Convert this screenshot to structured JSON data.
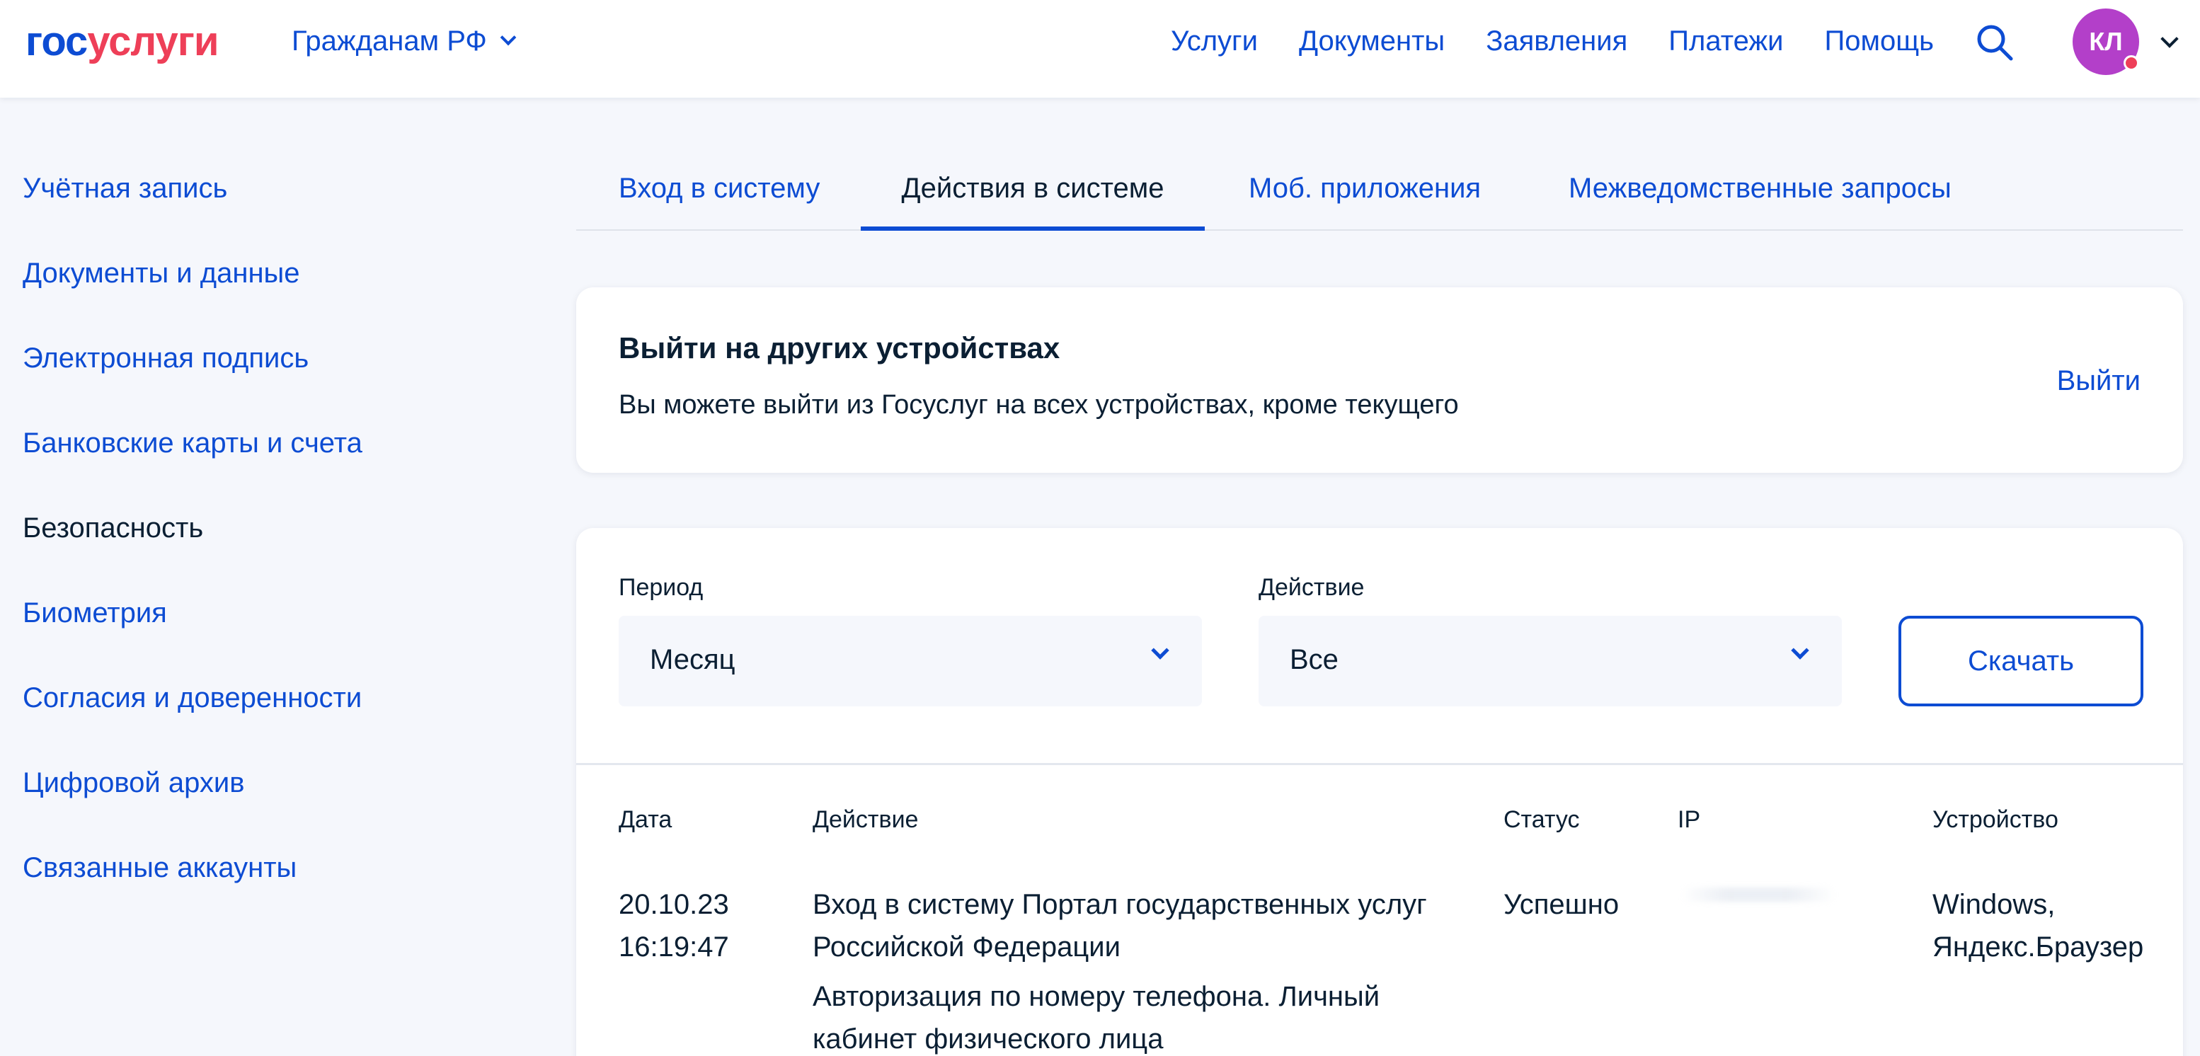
{
  "header": {
    "logo": {
      "part1": "гос",
      "part2": "услуги"
    },
    "audience": "Гражданам РФ",
    "nav": [
      "Услуги",
      "Документы",
      "Заявления",
      "Платежи",
      "Помощь"
    ],
    "avatar_initials": "КЛ",
    "colors": {
      "brand_blue": "#0d4cd3",
      "brand_red": "#ee3f58",
      "avatar": "#b33fc9"
    }
  },
  "sidebar": {
    "items": [
      {
        "label": "Учётная запись"
      },
      {
        "label": "Документы и данные"
      },
      {
        "label": "Электронная подпись"
      },
      {
        "label": "Банковские карты и счета"
      },
      {
        "label": "Безопасность",
        "active": true
      },
      {
        "label": "Биометрия"
      },
      {
        "label": "Согласия и доверенности"
      },
      {
        "label": "Цифровой архив"
      },
      {
        "label": "Связанные аккаунты"
      }
    ]
  },
  "tabs": [
    {
      "label": "Вход в систему"
    },
    {
      "label": "Действия в системе",
      "active": true
    },
    {
      "label": "Моб. приложения"
    },
    {
      "label": "Межведомственные запросы"
    }
  ],
  "logout_card": {
    "title": "Выйти на других устройствах",
    "description": "Вы можете выйти из Госуслуг на всех устройствах, кроме текущего",
    "action": "Выйти"
  },
  "filters": {
    "period": {
      "label": "Период",
      "value": "Месяц"
    },
    "action": {
      "label": "Действие",
      "value": "Все"
    },
    "download_label": "Скачать"
  },
  "table": {
    "columns": [
      "Дата",
      "Действие",
      "Статус",
      "IP",
      "Устройство"
    ],
    "rows": [
      {
        "date": "20.10.23",
        "time": "16:19:47",
        "action_line1": "Вход в систему Портал государственных услуг",
        "action_line2": "Российской Федерации",
        "action_detail_line1": "Авторизация по номеру телефона. Личный",
        "action_detail_line2": "кабинет физического лица",
        "status": "Успешно",
        "device_line1": "Windows,",
        "device_line2": "Яндекс.Браузер"
      }
    ]
  }
}
